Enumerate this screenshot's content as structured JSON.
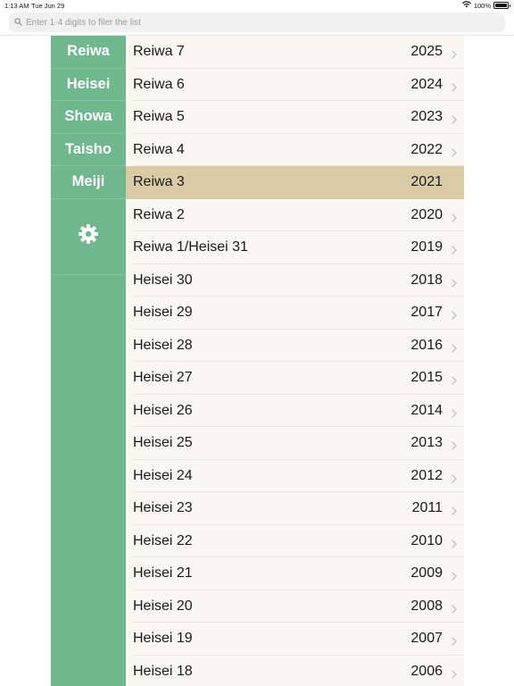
{
  "status_bar": {
    "time": "1:13 AM",
    "date": "Tue Jun 29",
    "battery_pct": "100%",
    "icons": [
      "wifi-icon",
      "battery-icon"
    ]
  },
  "search": {
    "placeholder": "Enter 1-4 digits to filer the list",
    "value": "",
    "icon": "search-icon"
  },
  "sidebar": {
    "eras": [
      {
        "label": "Reiwa"
      },
      {
        "label": "Heisei"
      },
      {
        "label": "Showa"
      },
      {
        "label": "Taisho"
      },
      {
        "label": "Meiji"
      }
    ],
    "settings_icon": "gear-icon"
  },
  "list": {
    "selected_index": 4,
    "rows": [
      {
        "name": "Reiwa 7",
        "year": "2025"
      },
      {
        "name": "Reiwa 6",
        "year": "2024"
      },
      {
        "name": "Reiwa 5",
        "year": "2023"
      },
      {
        "name": "Reiwa 4",
        "year": "2022"
      },
      {
        "name": "Reiwa 3",
        "year": "2021"
      },
      {
        "name": "Reiwa 2",
        "year": "2020"
      },
      {
        "name": "Reiwa 1/Heisei 31",
        "year": "2019"
      },
      {
        "name": "Heisei 30",
        "year": "2018"
      },
      {
        "name": "Heisei 29",
        "year": "2017"
      },
      {
        "name": "Heisei 28",
        "year": "2016"
      },
      {
        "name": "Heisei 27",
        "year": "2015"
      },
      {
        "name": "Heisei 26",
        "year": "2014"
      },
      {
        "name": "Heisei 25",
        "year": "2013"
      },
      {
        "name": "Heisei 24",
        "year": "2012"
      },
      {
        "name": "Heisei 23",
        "year": "2011"
      },
      {
        "name": "Heisei 22",
        "year": "2010"
      },
      {
        "name": "Heisei 21",
        "year": "2009"
      },
      {
        "name": "Heisei 20",
        "year": "2008"
      },
      {
        "name": "Heisei 19",
        "year": "2007"
      },
      {
        "name": "Heisei 18",
        "year": "2006"
      }
    ]
  },
  "colors": {
    "sidebar_bg": "#6fb88e",
    "list_bg": "#faf7f0",
    "selected_row_bg": "#d9cba6"
  }
}
